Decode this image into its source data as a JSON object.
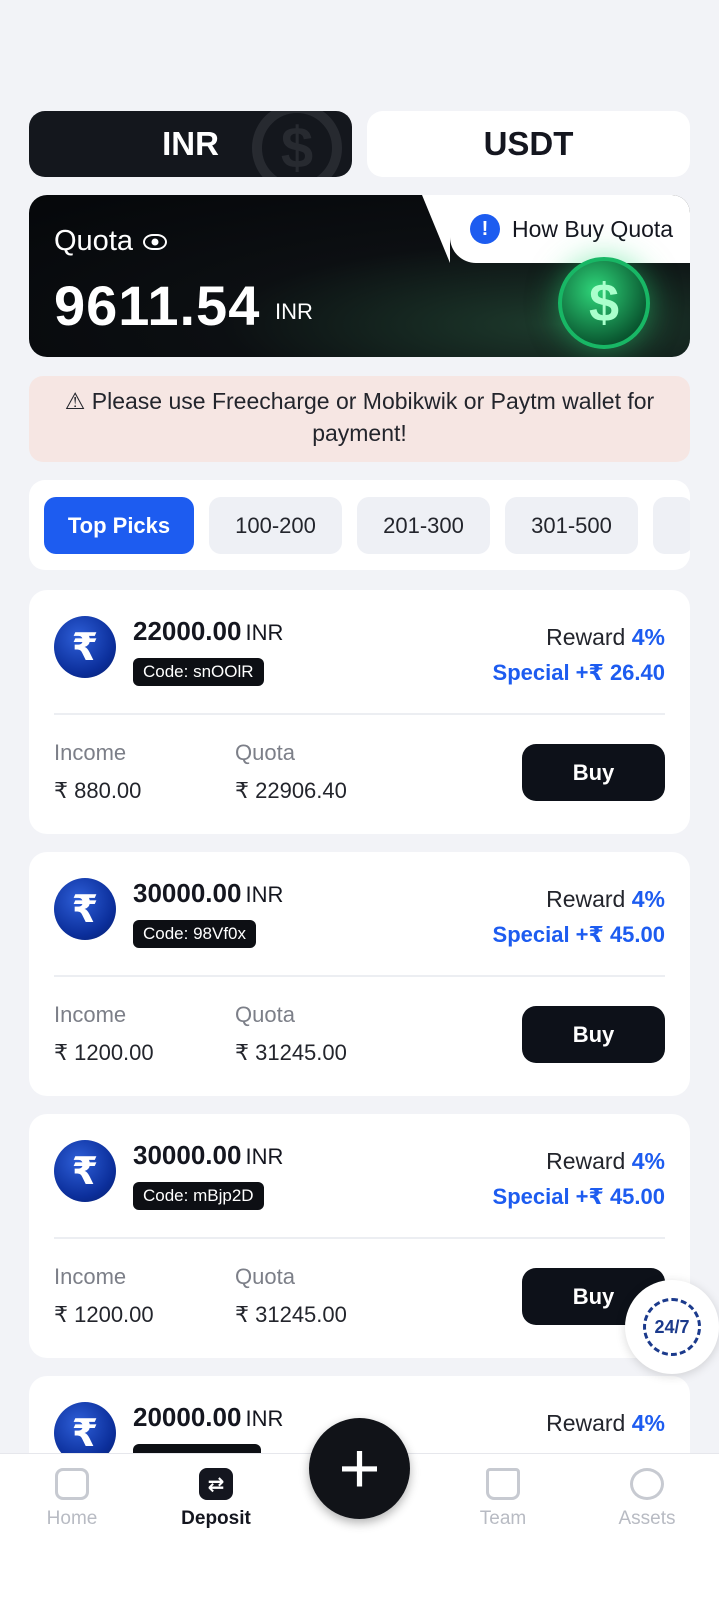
{
  "currency_tabs": {
    "inr": "INR",
    "usdt": "USDT"
  },
  "quota": {
    "label": "Quota",
    "amount": "9611.54",
    "unit": "INR",
    "how_buy": "How Buy Quota"
  },
  "notice": "⚠ Please use Freecharge or Mobikwik or Paytm wallet for payment!",
  "filters": [
    "Top Picks",
    "100-200",
    "201-300",
    "301-500"
  ],
  "offers": [
    {
      "amount": "22000.00",
      "unit": "INR",
      "code": "Code: snOOlR",
      "reward_label": "Reward",
      "reward_pct": "4%",
      "special": "Special +₹ 26.40",
      "income_label": "Income",
      "income": "₹ 880.00",
      "quota_label": "Quota",
      "quota": "₹ 22906.40",
      "buy": "Buy"
    },
    {
      "amount": "30000.00",
      "unit": "INR",
      "code": "Code: 98Vf0x",
      "reward_label": "Reward",
      "reward_pct": "4%",
      "special": "Special +₹ 45.00",
      "income_label": "Income",
      "income": "₹ 1200.00",
      "quota_label": "Quota",
      "quota": "₹ 31245.00",
      "buy": "Buy"
    },
    {
      "amount": "30000.00",
      "unit": "INR",
      "code": "Code: mBjp2D",
      "reward_label": "Reward",
      "reward_pct": "4%",
      "special": "Special +₹ 45.00",
      "income_label": "Income",
      "income": "₹ 1200.00",
      "quota_label": "Quota",
      "quota": "₹ 31245.00",
      "buy": "Buy"
    },
    {
      "amount": "20000.00",
      "unit": "INR",
      "reward_label": "Reward",
      "reward_pct": "4%"
    }
  ],
  "support_label": "24/7",
  "nav": {
    "home": "Home",
    "deposit": "Deposit",
    "team": "Team",
    "assets": "Assets"
  },
  "colors": {
    "accent": "#1d5cf0",
    "dark": "#14171d",
    "notice_bg": "#f6e6e3"
  }
}
